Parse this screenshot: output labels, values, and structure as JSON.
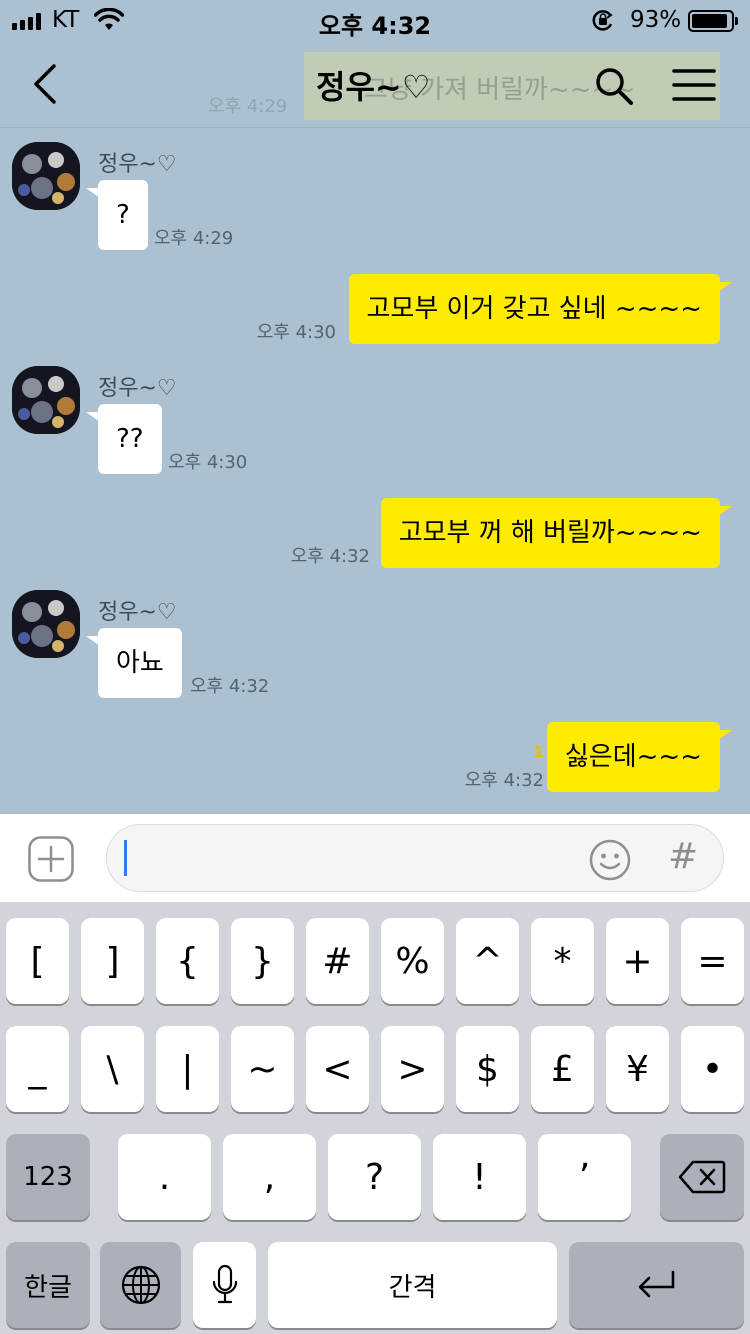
{
  "status_bar": {
    "carrier": "KT",
    "time": "오후 4:32",
    "battery": "93%"
  },
  "header": {
    "title": "정우~♡",
    "ghost_bubble_text": "그냥 가져 버릴까~~~~",
    "ghost_time": "오후 4:29"
  },
  "messages": [
    {
      "from": "other",
      "sender": "정우~♡",
      "text": "?",
      "time": "오후 4:29"
    },
    {
      "from": "me",
      "text": "고모부 이거 갖고 싶네 ~~~~",
      "time": "오후 4:30"
    },
    {
      "from": "other",
      "sender": "정우~♡",
      "text": "??",
      "time": "오후 4:30"
    },
    {
      "from": "me",
      "text": "고모부 꺼 해 버릴까~~~~",
      "time": "오후 4:32"
    },
    {
      "from": "other",
      "sender": "정우~♡",
      "text": "아뇨",
      "time": "오후 4:32"
    },
    {
      "from": "me",
      "text": "싫은데~~~",
      "time": "오후 4:32",
      "unread": "1"
    }
  ],
  "input": {
    "hash_label": "#"
  },
  "keyboard": {
    "row1": [
      "[",
      "]",
      "{",
      "}",
      "#",
      "%",
      "^",
      "*",
      "+",
      "="
    ],
    "row2": [
      "_",
      "\\",
      "|",
      "~",
      "<",
      ">",
      "$",
      "£",
      "¥",
      "•"
    ],
    "row3": [
      "123",
      ".",
      ",",
      "?",
      "!",
      "’"
    ],
    "row4": {
      "lang": "한글",
      "space": "간격"
    }
  },
  "colors": {
    "chat_background": "#abc1d1",
    "my_bubble": "#ffeb00",
    "their_bubble": "#ffffff",
    "unread": "#e3c100"
  }
}
